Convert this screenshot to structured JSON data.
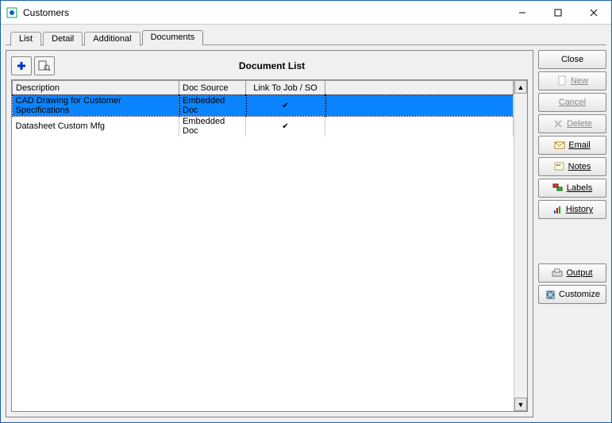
{
  "window": {
    "title": "Customers"
  },
  "tabs": [
    {
      "label": "List"
    },
    {
      "label": "Detail"
    },
    {
      "label": "Additional"
    },
    {
      "label": "Documents"
    }
  ],
  "panel": {
    "title": "Document List",
    "columns": {
      "description": "Description",
      "doc_source": "Doc Source",
      "link_to": "Link To Job / SO"
    },
    "rows": [
      {
        "description": "CAD Drawing for Customer Specifications",
        "doc_source": "Embedded Doc",
        "link": true,
        "selected": true
      },
      {
        "description": "Datasheet Custom Mfg",
        "doc_source": "Embedded Doc",
        "link": true,
        "selected": false
      }
    ]
  },
  "buttons": {
    "close": "Close",
    "new": "New",
    "cancel": "Cancel",
    "delete": "Delete",
    "email": "Email",
    "notes": "Notes",
    "labels": "Labels",
    "history": "History",
    "output": "Output",
    "customize": "Customize"
  }
}
